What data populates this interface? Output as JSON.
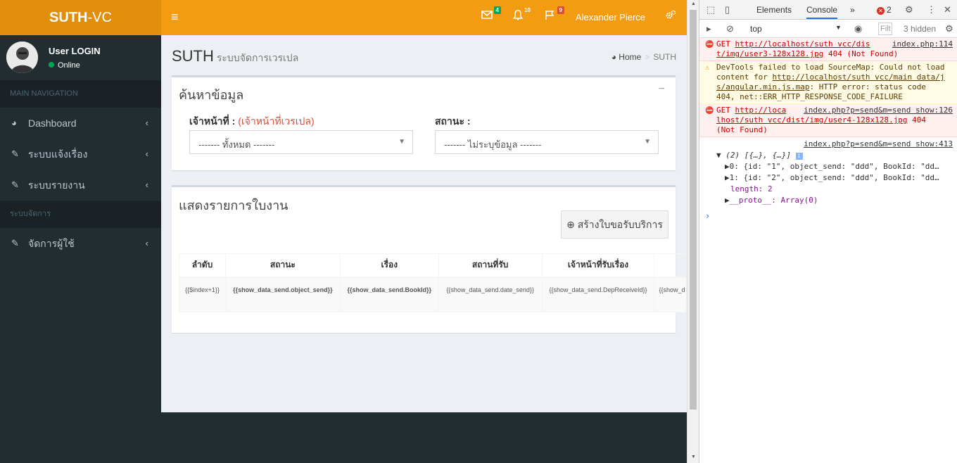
{
  "logo": {
    "bold": "SUTH",
    "rest": "-VC"
  },
  "topbar": {
    "menu_icon": "≡",
    "mail_badge": "4",
    "bell_badge": "10",
    "flag_badge": "9",
    "username": "Alexander Pierce"
  },
  "colors": {
    "topbar": "#f39c12",
    "logo": "#e08e0b",
    "sidebar": "#222d32",
    "badge_green": "#00a65a",
    "badge_yellow": "#f39c12",
    "badge_red": "#dd4b39"
  },
  "sidebar": {
    "user_name": "User LOGIN",
    "user_status": "Online",
    "header_main": "MAIN NAVIGATION",
    "items": [
      {
        "label": "Dashboard",
        "icon": "dashboard-icon"
      },
      {
        "label": "ระบบแจ้งเรื่อง",
        "icon": "edit-icon"
      },
      {
        "label": "ระบบรายงาน",
        "icon": "edit-icon"
      }
    ],
    "header_manage": "ระบบจัดการ",
    "manage_items": [
      {
        "label": "จัดการผู้ใช้",
        "icon": "edit-icon"
      }
    ]
  },
  "page": {
    "title": "SUTH",
    "subtitle": "ระบบจัดการเวรเปล",
    "breadcrumb_home": "Home",
    "breadcrumb_current": "SUTH"
  },
  "search_box": {
    "title": "ค้นหาข้อมูล",
    "officer_label": "เจ้าหน้าที่ :",
    "officer_note": "(เจ้าหน้าที่เวรเปล)",
    "officer_value": "------- ทั้งหมด -------",
    "status_label": "สถานะ :",
    "status_value": "------- ไม่ระบุข้อมูล -------"
  },
  "list_box": {
    "title": "แสดงรายการใบงาน",
    "add_button": "สร้างใบขอรับบริการ",
    "columns": [
      "ลำดับ",
      "สถานะ",
      "เรื่อง",
      "สถานที่รับ",
      "เจ้าหน้าที่รับเรื่อง",
      ""
    ],
    "row": [
      "{{$index+1}}",
      "{{show_data_send.object_send}}",
      "{{show_data_send.BookId}}",
      "{{show_data_send.date_send}}",
      "{{show_data_send.DepReceiveId}}",
      "{{show_d"
    ]
  },
  "devtools": {
    "tabs": [
      "Elements",
      "Console"
    ],
    "more": "»",
    "error_count": "2",
    "context": "top",
    "filter_placeholder": "Filt",
    "hidden": "3 hidden",
    "messages": [
      {
        "type": "error",
        "method": "GET",
        "url": "http://localhost/suth_vcc/dist/img/user3-128x128.jpg",
        "url_a": "http://localhost/suth vcc/dis",
        "url_b": "t/img/user3-128x128.jpg",
        "status": "404 (Not Found)",
        "source": "index.php:114"
      },
      {
        "type": "warning",
        "line1": "DevTools failed to load SourceMap: Could not load",
        "line2_pre": "content for ",
        "line2_link": "http://localhost/suth vcc/main data/j",
        "line3_link": "s/angular.min.js.map",
        "line3_post": ": HTTP error: status code",
        "line4": "404, net::ERR_HTTP_RESPONSE_CODE_FAILURE"
      },
      {
        "type": "error",
        "method": "GET",
        "url_a": "http://loca",
        "url_b": "lhost/suth vcc/dist/img/user4-128x128.jpg",
        "status_a": "404",
        "status_b": "(Not Found)",
        "source": "index.php?p=send&m=send show:126"
      }
    ],
    "log": {
      "source": "index.php?p=send&m=send show:413",
      "summary": "(2) [{…}, {…}]",
      "item0": "0: {id: \"1\", object_send: \"ddd\", BookId: \"dd…",
      "item1": "1: {id: \"2\", object_send: \"ddd\", BookId: \"dd…",
      "length": "length: 2",
      "proto": "__proto__: Array(0)"
    }
  }
}
